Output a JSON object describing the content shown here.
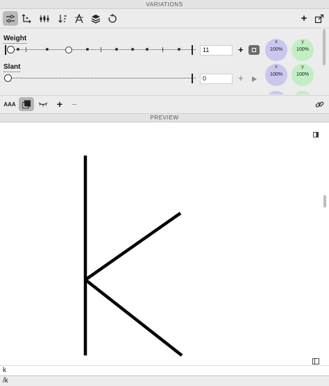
{
  "window": {
    "title": "VARIATIONS"
  },
  "toolbar": {
    "icons": [
      "sliders-icon",
      "axes-icon",
      "masters-icon",
      "sort-icon",
      "font-icon",
      "layers-icon",
      "reset-icon"
    ],
    "add_label": "+"
  },
  "axes": [
    {
      "name": "Weight",
      "value": "11",
      "add_label": "+",
      "x_label": "x",
      "y_label": "y",
      "x_percent": "100%",
      "y_percent": "100%"
    },
    {
      "name": "Slant",
      "value": "0",
      "add_label": "+",
      "x_label": "x",
      "y_label": "y",
      "x_percent": "100%",
      "y_percent": "100%"
    }
  ],
  "bottom_toolbar": {
    "text_size_label": "AAA",
    "add_label": "+",
    "remove_label": "−"
  },
  "preview": {
    "title": "PREVIEW",
    "glyph": "k",
    "text_line": "k",
    "glyph_name_line": "/k"
  },
  "colors": {
    "x_circle": "#c9c7ee",
    "y_circle": "#c2eec4",
    "active_button": "#b9b9b9"
  }
}
